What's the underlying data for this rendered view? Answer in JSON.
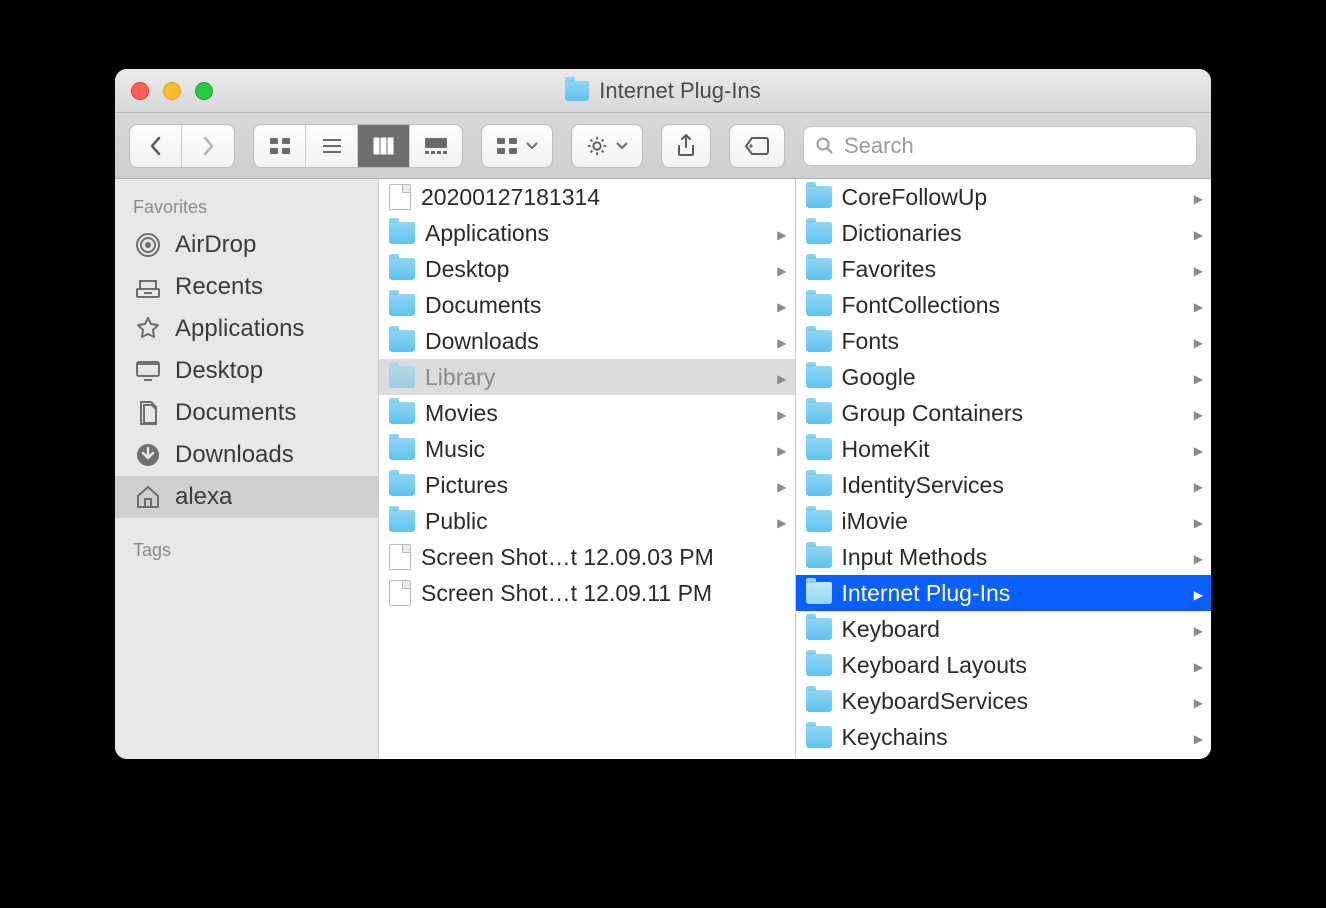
{
  "window": {
    "title": "Internet Plug-Ins"
  },
  "toolbar": {
    "search_placeholder": "Search"
  },
  "sidebar": {
    "favorites_header": "Favorites",
    "tags_header": "Tags",
    "items": [
      {
        "label": "AirDrop",
        "icon": "airdrop"
      },
      {
        "label": "Recents",
        "icon": "recents"
      },
      {
        "label": "Applications",
        "icon": "applications"
      },
      {
        "label": "Desktop",
        "icon": "desktop"
      },
      {
        "label": "Documents",
        "icon": "documents"
      },
      {
        "label": "Downloads",
        "icon": "downloads"
      },
      {
        "label": "alexa",
        "icon": "home",
        "selected": true
      }
    ]
  },
  "columns": [
    {
      "items": [
        {
          "label": "20200127181314",
          "type": "file"
        },
        {
          "label": "Applications",
          "type": "folder",
          "expandable": true
        },
        {
          "label": "Desktop",
          "type": "folder",
          "expandable": true
        },
        {
          "label": "Documents",
          "type": "folder",
          "expandable": true
        },
        {
          "label": "Downloads",
          "type": "folder",
          "expandable": true
        },
        {
          "label": "Library",
          "type": "folder",
          "expandable": true,
          "selected": "dim"
        },
        {
          "label": "Movies",
          "type": "folder",
          "expandable": true
        },
        {
          "label": "Music",
          "type": "folder",
          "expandable": true
        },
        {
          "label": "Pictures",
          "type": "folder",
          "expandable": true
        },
        {
          "label": "Public",
          "type": "folder",
          "expandable": true
        },
        {
          "label": "Screen Shot…t 12.09.03 PM",
          "type": "file"
        },
        {
          "label": "Screen Shot…t 12.09.11 PM",
          "type": "file"
        }
      ]
    },
    {
      "items": [
        {
          "label": "CoreFollowUp",
          "type": "folder",
          "expandable": true
        },
        {
          "label": "Dictionaries",
          "type": "folder",
          "expandable": true
        },
        {
          "label": "Favorites",
          "type": "folder",
          "expandable": true
        },
        {
          "label": "FontCollections",
          "type": "folder",
          "expandable": true
        },
        {
          "label": "Fonts",
          "type": "folder",
          "expandable": true
        },
        {
          "label": "Google",
          "type": "folder",
          "expandable": true
        },
        {
          "label": "Group Containers",
          "type": "folder",
          "expandable": true
        },
        {
          "label": "HomeKit",
          "type": "folder",
          "expandable": true
        },
        {
          "label": "IdentityServices",
          "type": "folder",
          "expandable": true
        },
        {
          "label": "iMovie",
          "type": "folder",
          "expandable": true
        },
        {
          "label": "Input Methods",
          "type": "folder",
          "expandable": true
        },
        {
          "label": "Internet Plug-Ins",
          "type": "folder",
          "expandable": true,
          "selected": "blue"
        },
        {
          "label": "Keyboard",
          "type": "folder",
          "expandable": true
        },
        {
          "label": "Keyboard Layouts",
          "type": "folder",
          "expandable": true
        },
        {
          "label": "KeyboardServices",
          "type": "folder",
          "expandable": true
        },
        {
          "label": "Keychains",
          "type": "folder",
          "expandable": true
        }
      ]
    }
  ]
}
